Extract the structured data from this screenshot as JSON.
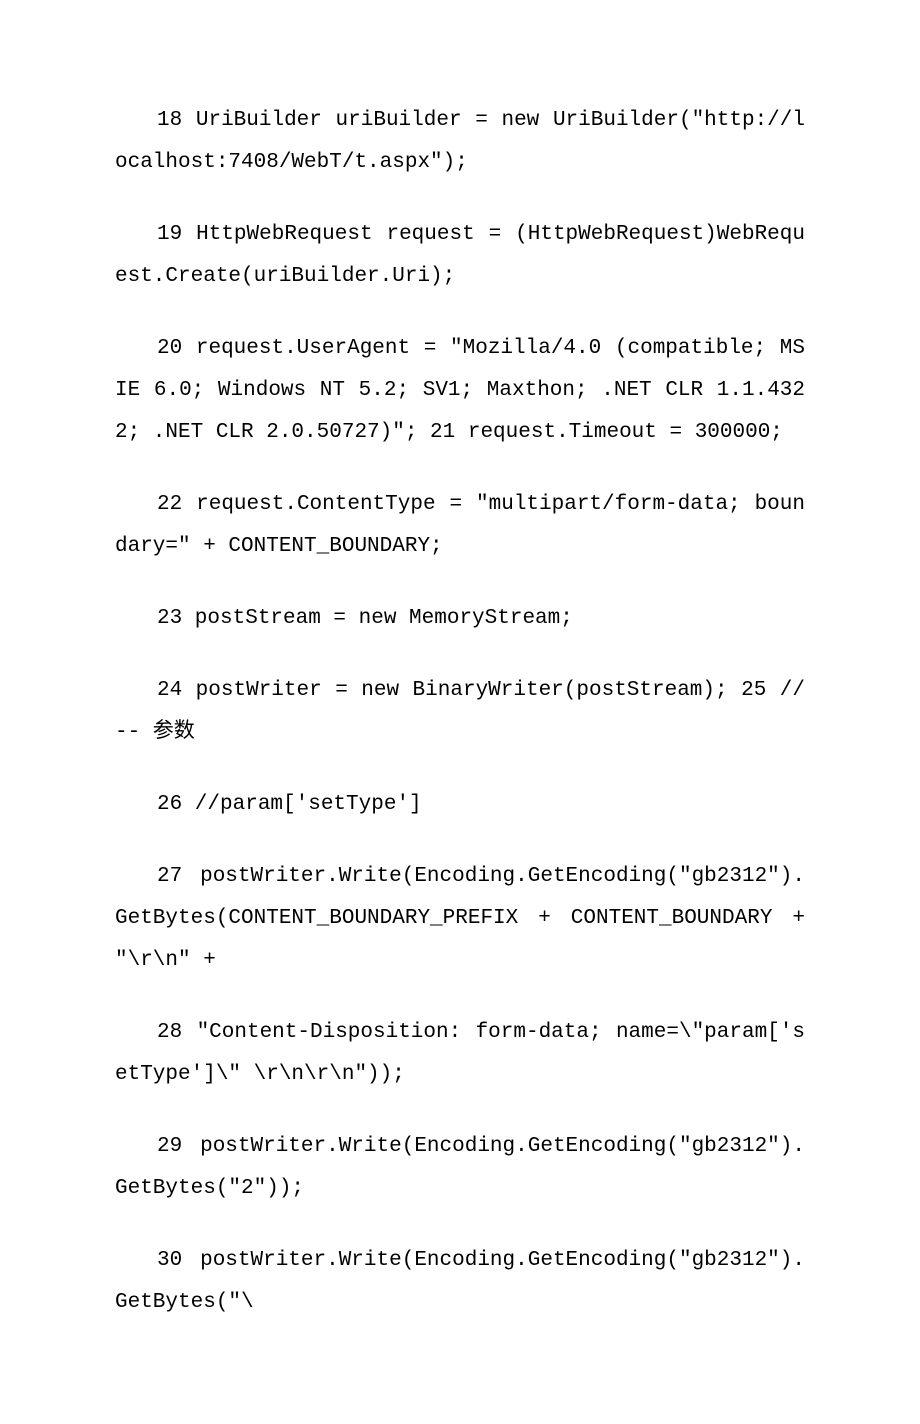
{
  "paragraphs": [
    {
      "indent": true,
      "text": "18                       UriBuilder  uriBuilder  =  new UriBuilder(\"http://localhost:7408/WebT/t.aspx\");"
    },
    {
      "indent": true,
      "text": "19                          HttpWebRequest  request  = (HttpWebRequest)WebRequest.Create(uriBuilder.Uri);"
    },
    {
      "indent": true,
      "text": "20                     request.UserAgent  =  \"Mozilla/4.0 (compatible;  MSIE  6.0;  Windows  NT  5.2;  SV1;  Maxthon;  .NET  CLR 1.1.4322;      .NET      CLR      2.0.50727)\";              21 request.Timeout = 300000;"
    },
    {
      "indent": true,
      "text": "22              request.ContentType = \"multipart/form-data; boundary=\" + CONTENT_BOUNDARY;"
    },
    {
      "indent": true,
      "text": "23              postStream = new MemoryStream;"
    },
    {
      "indent": true,
      "text": "24               postWriter = new BinaryWriter(postStream); 25             //-- 参数"
    },
    {
      "indent": true,
      "text": "26              //param['setType']"
    },
    {
      "indent": true,
      "text": "27 postWriter.Write(Encoding.GetEncoding(\"gb2312\").GetBytes(CONTENT_BOUNDARY_PREFIX + CONTENT_BOUNDARY + \"\\r\\n\" +"
    },
    {
      "indent": true,
      "text": "28                     \"Content-Disposition:  form-data; name=\\\"param['setType']\\\" \\r\\n\\r\\n\"));"
    },
    {
      "indent": true,
      "text": "29 postWriter.Write(Encoding.GetEncoding(\"gb2312\").GetBytes(\"2\"));"
    },
    {
      "indent": true,
      "text": "30 postWriter.Write(Encoding.GetEncoding(\"gb2312\").GetBytes(\"\\"
    }
  ]
}
